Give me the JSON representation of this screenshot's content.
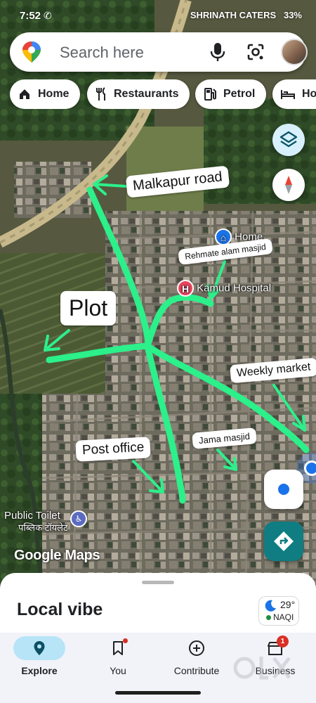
{
  "status_bar": {
    "time": "7:52",
    "notification": "SHRINATH CATERS",
    "battery": "33%"
  },
  "search": {
    "placeholder": "Search here"
  },
  "chips": [
    {
      "label": "Home",
      "icon": "home-icon"
    },
    {
      "label": "Restaurants",
      "icon": "fork-knife-icon"
    },
    {
      "label": "Petrol",
      "icon": "fuel-pump-icon"
    },
    {
      "label": "Hot",
      "icon": "bed-icon"
    }
  ],
  "map": {
    "place_labels": {
      "home": "Home",
      "hospital": "Kamud Hospital",
      "toilet_en": "Public Toilet",
      "toilet_hi": "पब्लिक टॉयलेट"
    },
    "annotations": {
      "malkapur_road": "Malkapur road",
      "rehmate_alam_masjid": "Rehmate alam masjid",
      "plot": "Plot",
      "weekly_market": "Weekly market",
      "post_office": "Post office",
      "jama_masjid": "Jama masjid"
    },
    "annotation_color": "#2cf08a",
    "logo_text": "Google Maps"
  },
  "sheet": {
    "title": "Local vibe",
    "weather": {
      "temperature": "29°",
      "aqi": "NAQI",
      "icon": "moon-icon"
    }
  },
  "nav": {
    "items": [
      {
        "label": "Explore",
        "icon": "location-pin-icon",
        "active": true
      },
      {
        "label": "You",
        "icon": "bookmark-icon"
      },
      {
        "label": "Contribute",
        "icon": "add-circle-icon"
      },
      {
        "label": "Business",
        "icon": "store-icon",
        "badge": "1"
      }
    ],
    "watermark": "OLX"
  }
}
